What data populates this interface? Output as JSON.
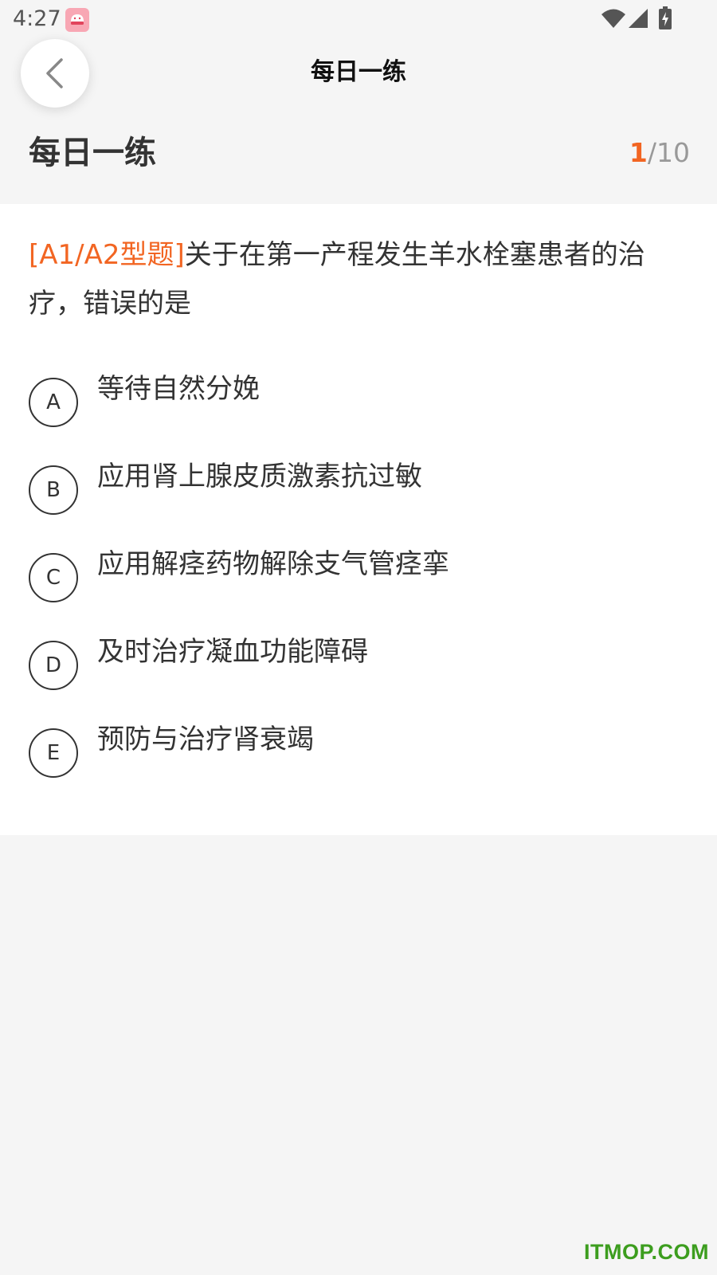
{
  "status_bar": {
    "time": "4:27"
  },
  "header": {
    "title": "每日一练"
  },
  "sub_header": {
    "title": "每日一练",
    "progress_current": "1",
    "progress_total": "/10"
  },
  "question": {
    "type_tag": "[A1/A2型题]",
    "stem": "关于在第一产程发生羊水栓塞患者的治疗，错误的是",
    "options": [
      {
        "letter": "A",
        "text": "等待自然分娩"
      },
      {
        "letter": "B",
        "text": "应用肾上腺皮质激素抗过敏"
      },
      {
        "letter": "C",
        "text": "应用解痉药物解除支气管痉挛"
      },
      {
        "letter": "D",
        "text": "及时治疗凝血功能障碍"
      },
      {
        "letter": "E",
        "text": "预防与治疗肾衰竭"
      }
    ]
  },
  "watermark": "ITMOP.COM",
  "colors": {
    "accent": "#f26522",
    "background": "#f5f5f5",
    "card": "#ffffff",
    "watermark": "#3c9d1e"
  },
  "icons": {
    "back": "chevron-left-icon",
    "wifi": "wifi-icon",
    "signal": "signal-icon",
    "battery": "battery-charging-icon",
    "app_notification": "app-notification-icon"
  }
}
